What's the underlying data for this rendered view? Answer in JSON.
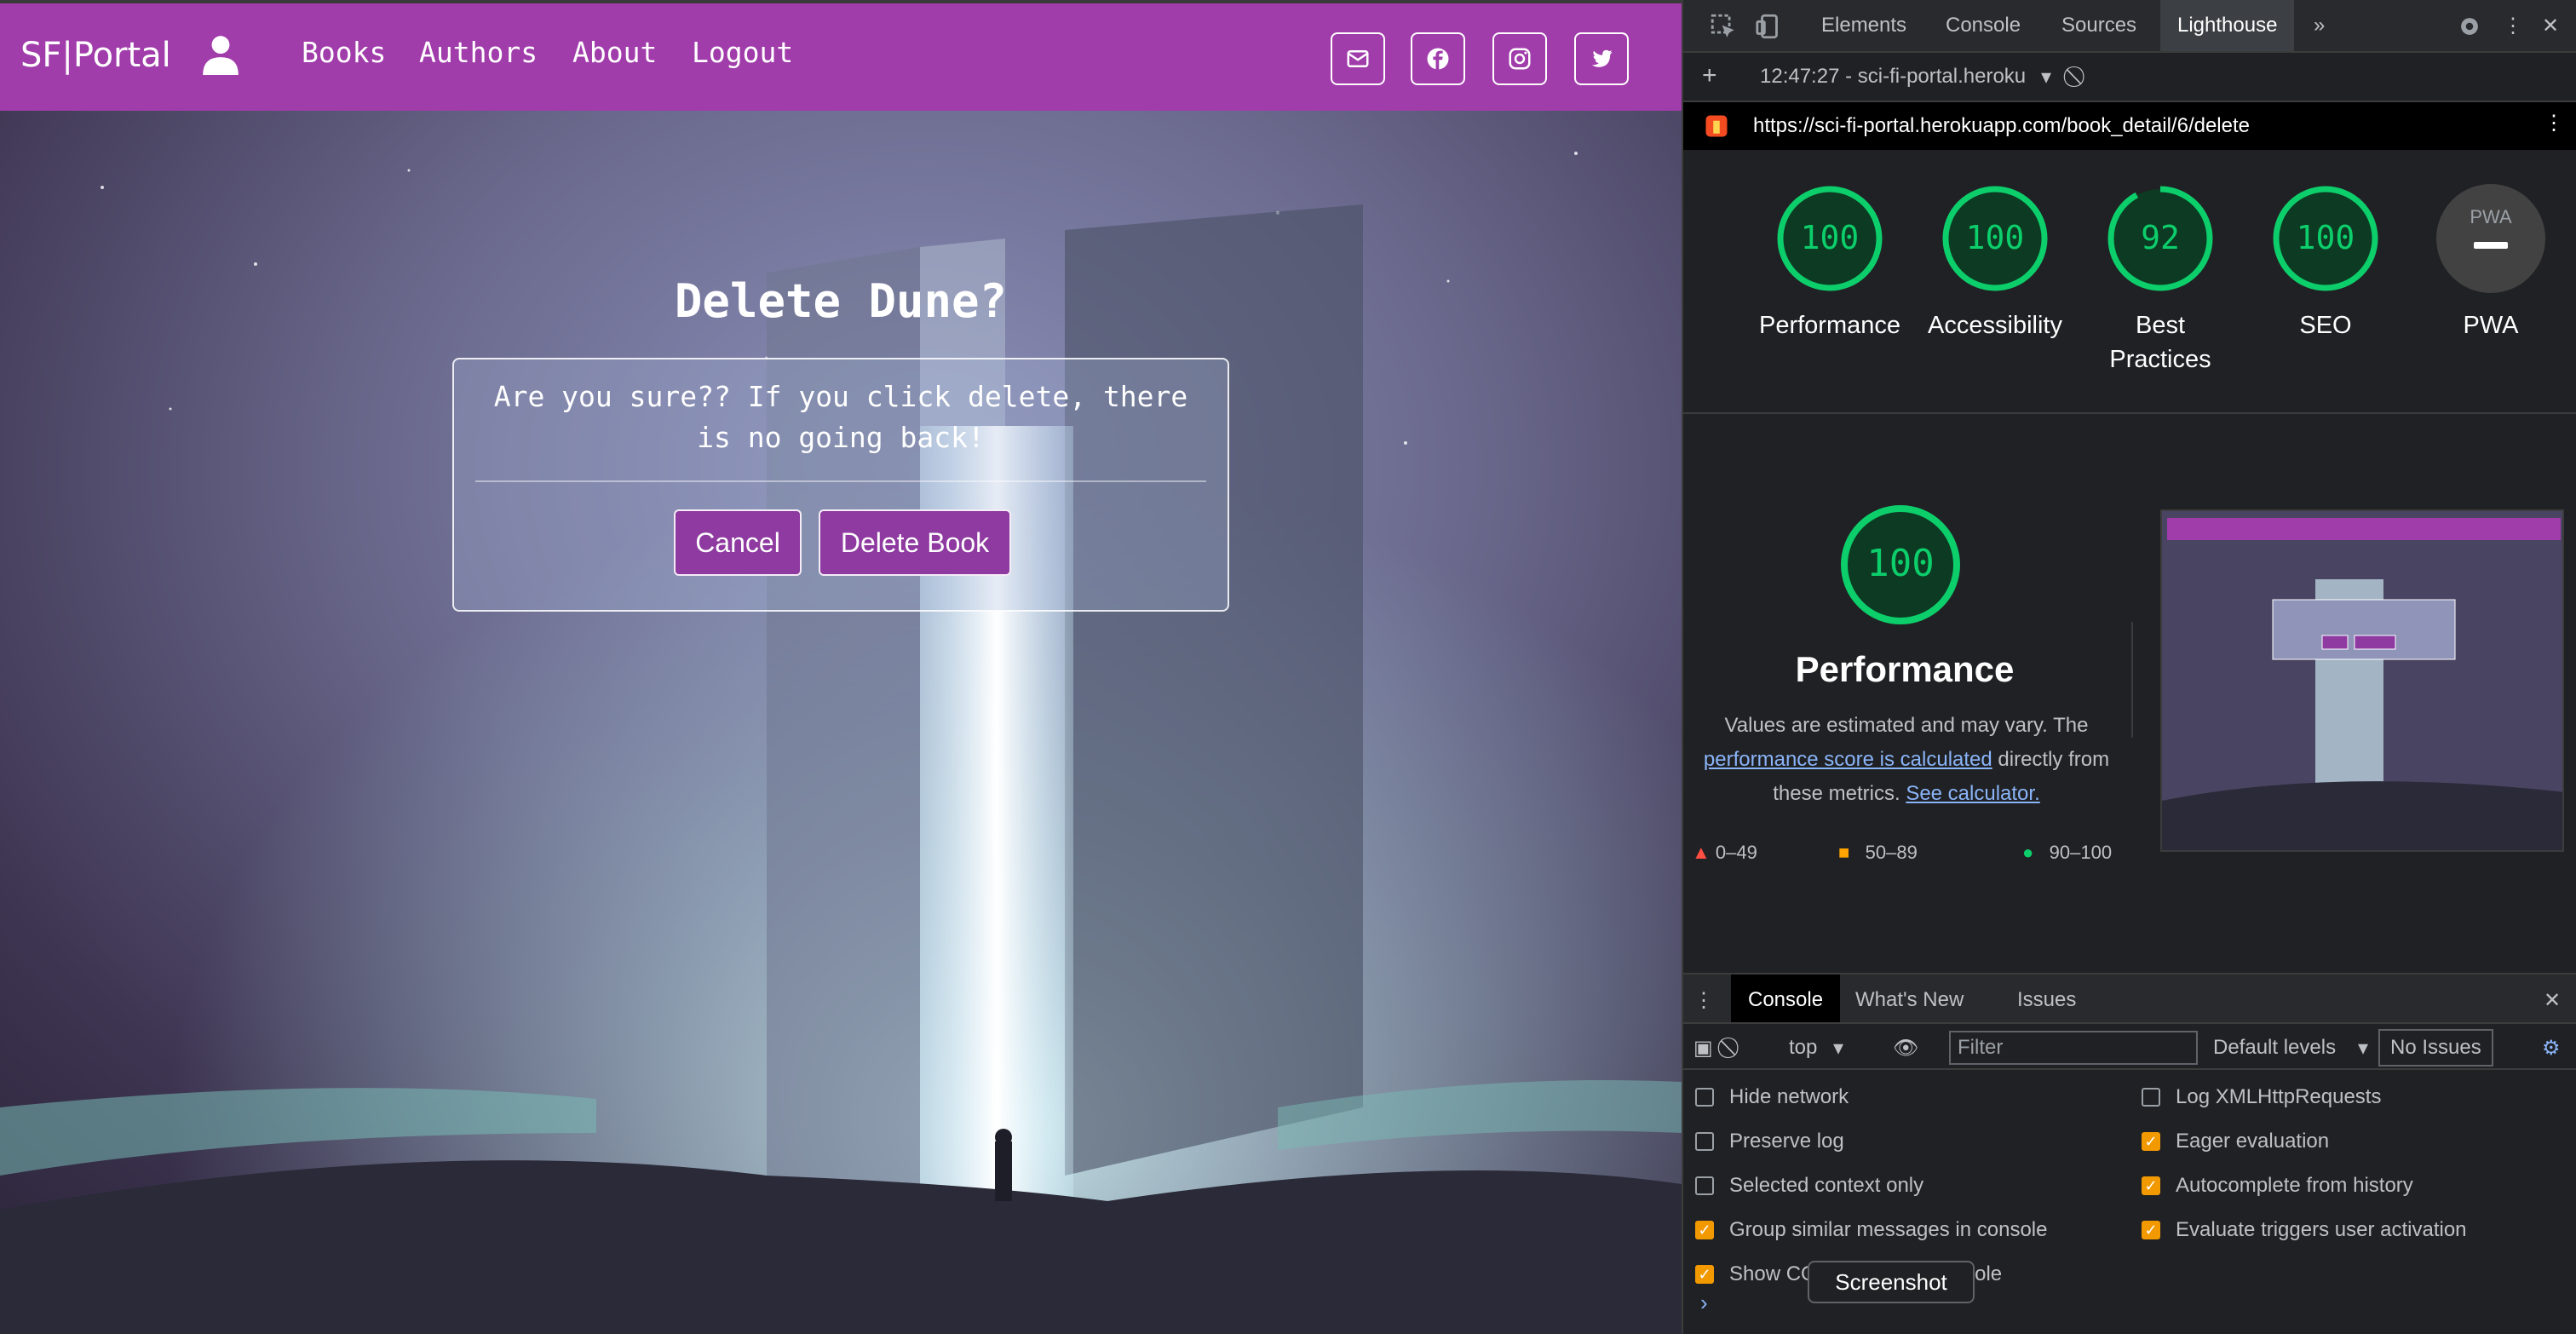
{
  "site": {
    "brand": "SF|Portal",
    "nav": [
      "Books",
      "Authors",
      "About",
      "Logout"
    ],
    "social_icons": [
      "envelope-icon",
      "facebook-icon",
      "instagram-icon",
      "twitter-icon"
    ],
    "dialog": {
      "title": "Delete Dune?",
      "message": "Are you sure?? If you click delete, there is no going back!",
      "cancel_label": "Cancel",
      "delete_label": "Delete Book"
    },
    "accent_color": "#a13cab"
  },
  "devtools": {
    "tabs": [
      "Elements",
      "Console",
      "Sources",
      "Lighthouse"
    ],
    "active_tab": "Lighthouse",
    "report_time": "12:47:27 - sci-fi-portal.heroku",
    "url": "https://sci-fi-portal.herokuapp.com/book_detail/6/delete",
    "scores": [
      {
        "label": "Performance",
        "value": "100",
        "fraction": 1.0
      },
      {
        "label": "Accessibility",
        "value": "100",
        "fraction": 1.0
      },
      {
        "label": "Best Practices",
        "value": "92",
        "fraction": 0.92
      },
      {
        "label": "SEO",
        "value": "100",
        "fraction": 1.0
      },
      {
        "label": "PWA",
        "value": "PWA",
        "fraction": 0
      }
    ],
    "performance": {
      "score": "100",
      "title": "Performance",
      "desc_prefix": "Values are estimated and may vary. The",
      "desc_link": "performance score is calculated",
      "desc_middle": "directly from these metrics.",
      "desc_link2": "See calculator."
    },
    "legend": [
      "0–49",
      "50–89",
      "90–100"
    ],
    "colors": {
      "pass": "#0cce6b",
      "average": "#ffa400",
      "fail": "#ff4e42"
    },
    "drawer_tabs": [
      "Console",
      "What's New",
      "Issues"
    ],
    "console_toolbar": {
      "context": "top",
      "filter_placeholder": "Filter",
      "levels": "Default levels",
      "issues": "No Issues"
    },
    "options_left": [
      {
        "label": "Hide network",
        "checked": false
      },
      {
        "label": "Preserve log",
        "checked": false
      },
      {
        "label": "Selected context only",
        "checked": false
      },
      {
        "label": "Group similar messages in console",
        "checked": true
      },
      {
        "label": "Show CORS errors in console",
        "checked": true
      }
    ],
    "options_right": [
      {
        "label": "Log XMLHttpRequests",
        "checked": false
      },
      {
        "label": "Eager evaluation",
        "checked": true
      },
      {
        "label": "Autocomplete from history",
        "checked": true
      },
      {
        "label": "Evaluate triggers user activation",
        "checked": true
      }
    ],
    "tooltip": "Screenshot",
    "prompt": "›"
  }
}
